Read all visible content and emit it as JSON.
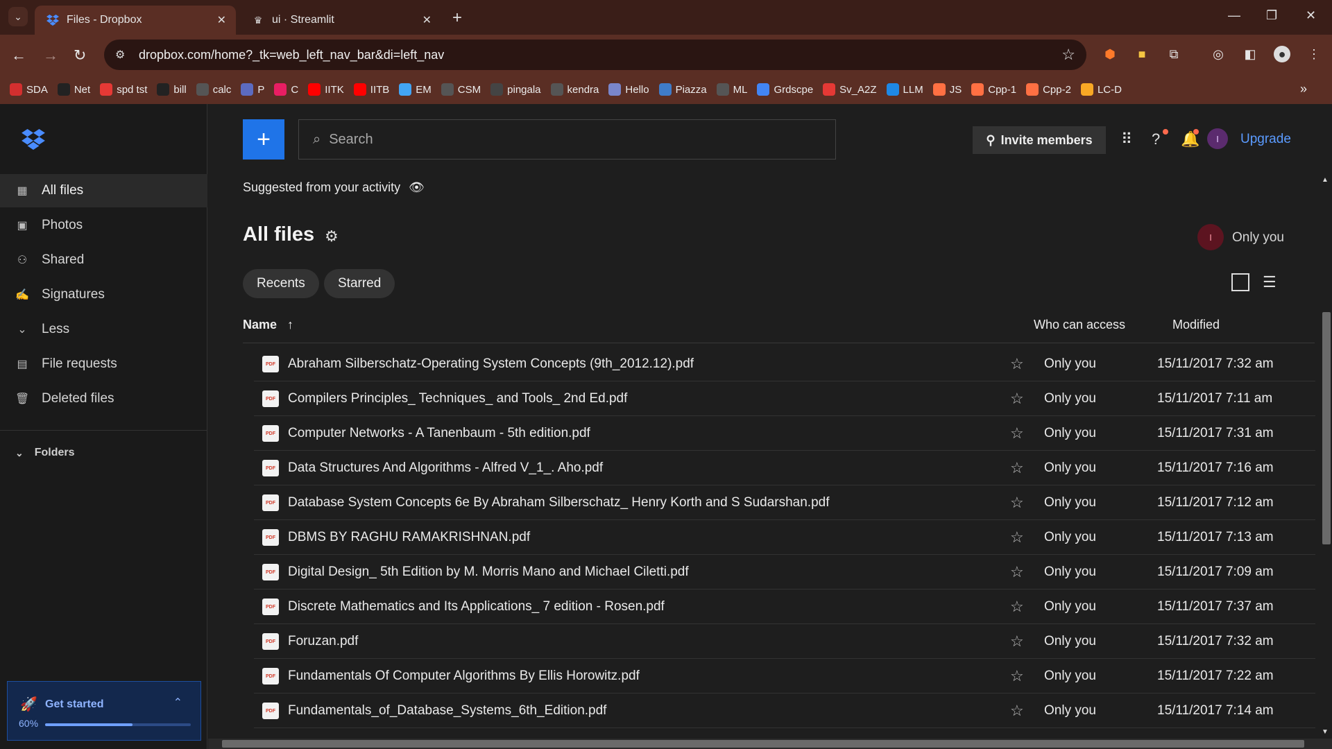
{
  "browser": {
    "tabs": [
      {
        "title": "Files - Dropbox",
        "icon": "dropbox-icon",
        "active": true
      },
      {
        "title": "ui · Streamlit",
        "icon": "streamlit-icon",
        "active": false
      }
    ],
    "url": "dropbox.com/home?_tk=web_left_nav_bar&di=left_nav",
    "bookmarks": [
      {
        "label": "SDA",
        "color": "#d32f2f"
      },
      {
        "label": "Net",
        "color": "#222222"
      },
      {
        "label": "spd tst",
        "color": "#e53935"
      },
      {
        "label": "bill",
        "color": "#222222"
      },
      {
        "label": "calc",
        "color": "#555555"
      },
      {
        "label": "P",
        "color": "#5c6bc0"
      },
      {
        "label": "C",
        "color": "#e91e63"
      },
      {
        "label": "IITK",
        "color": "#ff0000"
      },
      {
        "label": "IITB",
        "color": "#ff0000"
      },
      {
        "label": "EM",
        "color": "#42a5f5"
      },
      {
        "label": "CSM",
        "color": "#555555"
      },
      {
        "label": "pingala",
        "color": "#444444"
      },
      {
        "label": "kendra",
        "color": "#555555"
      },
      {
        "label": "Hello",
        "color": "#7986cb"
      },
      {
        "label": "Piazza",
        "color": "#3f7cc9"
      },
      {
        "label": "ML",
        "color": "#555555"
      },
      {
        "label": "Grdscpe",
        "color": "#4285f4"
      },
      {
        "label": "Sv_A2Z",
        "color": "#e53935"
      },
      {
        "label": "LLM",
        "color": "#1e88e5"
      },
      {
        "label": "JS",
        "color": "#ff7043"
      },
      {
        "label": "Cpp-1",
        "color": "#ff7043"
      },
      {
        "label": "Cpp-2",
        "color": "#ff7043"
      },
      {
        "label": "LC-D",
        "color": "#f9a825"
      }
    ]
  },
  "sidebar": {
    "items": [
      {
        "label": "All files",
        "icon": "all-files-icon"
      },
      {
        "label": "Photos",
        "icon": "photos-icon"
      },
      {
        "label": "Shared",
        "icon": "shared-icon"
      },
      {
        "label": "Signatures",
        "icon": "signature-icon"
      },
      {
        "label": "Less",
        "icon": "chevron-down-icon"
      },
      {
        "label": "File requests",
        "icon": "file-request-icon"
      },
      {
        "label": "Deleted files",
        "icon": "trash-icon"
      }
    ],
    "folders_label": "Folders",
    "get_started": {
      "label": "Get started",
      "percent_label": "60%",
      "progress": 0.6
    }
  },
  "header": {
    "search_placeholder": "Search",
    "invite_label": "Invite members",
    "upgrade_label": "Upgrade",
    "avatar_initial": "I"
  },
  "main": {
    "suggested_label": "Suggested from your activity",
    "title": "All files",
    "access_initial": "I",
    "access_label": "Only you",
    "chips": [
      "Recents",
      "Starred"
    ],
    "columns": {
      "name": "Name",
      "who": "Who can access",
      "modified": "Modified"
    },
    "files": [
      {
        "name": "Abraham Silberschatz-Operating System Concepts (9th_2012.12).pdf",
        "who": "Only you",
        "modified": "15/11/2017 7:32 am"
      },
      {
        "name": "Compilers Principles_ Techniques_ and Tools_ 2nd Ed.pdf",
        "who": "Only you",
        "modified": "15/11/2017 7:11 am"
      },
      {
        "name": "Computer Networks - A Tanenbaum - 5th edition.pdf",
        "who": "Only you",
        "modified": "15/11/2017 7:31 am"
      },
      {
        "name": "Data Structures And Algorithms - Alfred V_1_. Aho.pdf",
        "who": "Only you",
        "modified": "15/11/2017 7:16 am"
      },
      {
        "name": "Database System Concepts 6e By Abraham Silberschatz_ Henry Korth and S Sudarshan.pdf",
        "who": "Only you",
        "modified": "15/11/2017 7:12 am"
      },
      {
        "name": "DBMS BY RAGHU RAMAKRISHNAN.pdf",
        "who": "Only you",
        "modified": "15/11/2017 7:13 am"
      },
      {
        "name": "Digital Design_ 5th Edition by M. Morris Mano and Michael Ciletti.pdf",
        "who": "Only you",
        "modified": "15/11/2017 7:09 am"
      },
      {
        "name": "Discrete Mathematics and Its Applications_ 7 edition - Rosen.pdf",
        "who": "Only you",
        "modified": "15/11/2017 7:37 am"
      },
      {
        "name": "Foruzan.pdf",
        "who": "Only you",
        "modified": "15/11/2017 7:32 am"
      },
      {
        "name": "Fundamentals Of Computer Algorithms By Ellis Horowitz.pdf",
        "who": "Only you",
        "modified": "15/11/2017 7:22 am"
      },
      {
        "name": "Fundamentals_of_Database_Systems_6th_Edition.pdf",
        "who": "Only you",
        "modified": "15/11/2017 7:14 am"
      }
    ]
  },
  "colors": {
    "accent": "#1f74e8",
    "link": "#5b9bff",
    "chrome": "#5a2e24"
  }
}
